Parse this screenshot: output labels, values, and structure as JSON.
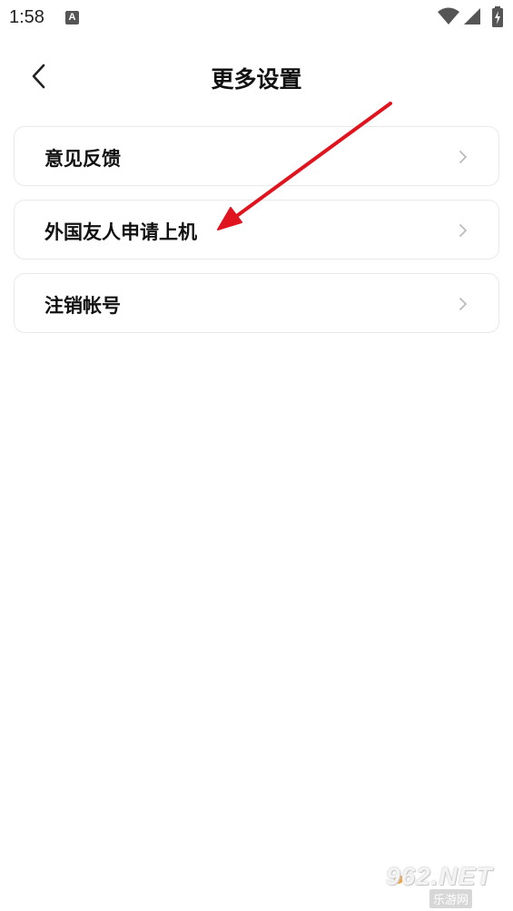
{
  "status_bar": {
    "time": "1:58",
    "notification_icon": "a-icon",
    "icons": [
      "wifi-icon",
      "signal-icon",
      "battery-charging-icon"
    ]
  },
  "header": {
    "title": "更多设置",
    "back_icon": "chevron-left-icon"
  },
  "menu": {
    "items": [
      {
        "label": "意见反馈"
      },
      {
        "label": "外国友人申请上机"
      },
      {
        "label": "注销帐号"
      }
    ],
    "chevron_icon": "chevron-right-icon"
  },
  "annotation": {
    "type": "red-arrow",
    "color": "#e0141e"
  },
  "watermark": {
    "text": "962.NET",
    "subtext": "乐游网"
  },
  "colors": {
    "background": "#ffffff",
    "card_border": "#e9e9e9",
    "text": "#111111",
    "chevron": "#bbbbbb"
  }
}
